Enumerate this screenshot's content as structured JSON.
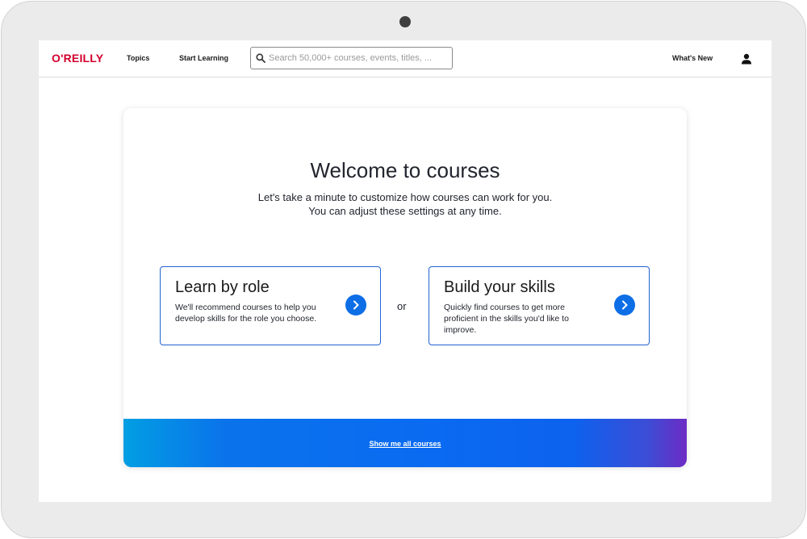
{
  "nav": {
    "logo": "O'REILLY",
    "topics": "Topics",
    "start_learning": "Start Learning",
    "search_placeholder": "Search 50,000+ courses, events, titles, ...",
    "whats_new": "What's New",
    "icons": {
      "search": "search-icon",
      "user": "user-icon"
    }
  },
  "card": {
    "title": "Welcome to courses",
    "subtitle_line1": "Let's take a minute to customize how courses can work for you.",
    "subtitle_line2": "You can adjust these settings at any time.",
    "options": [
      {
        "title": "Learn by role",
        "description": "We'll recommend courses to help you develop skills for the role you choose.",
        "icon": "chevron-right-icon"
      },
      {
        "title": "Build your skills",
        "description": "Quickly find courses to get more proficient in the skills you'd like to improve.",
        "icon": "chevron-right-icon"
      }
    ],
    "or_text": "or",
    "footer_link": "Show me all courses"
  },
  "colors": {
    "brand_red": "#d3002d",
    "accent_blue": "#0d6ee6",
    "option_border": "#1f63d1",
    "footer_gradient_start": "#029ee3",
    "footer_gradient_end": "#6d2bc4",
    "device_frame": "#ebebeb"
  }
}
